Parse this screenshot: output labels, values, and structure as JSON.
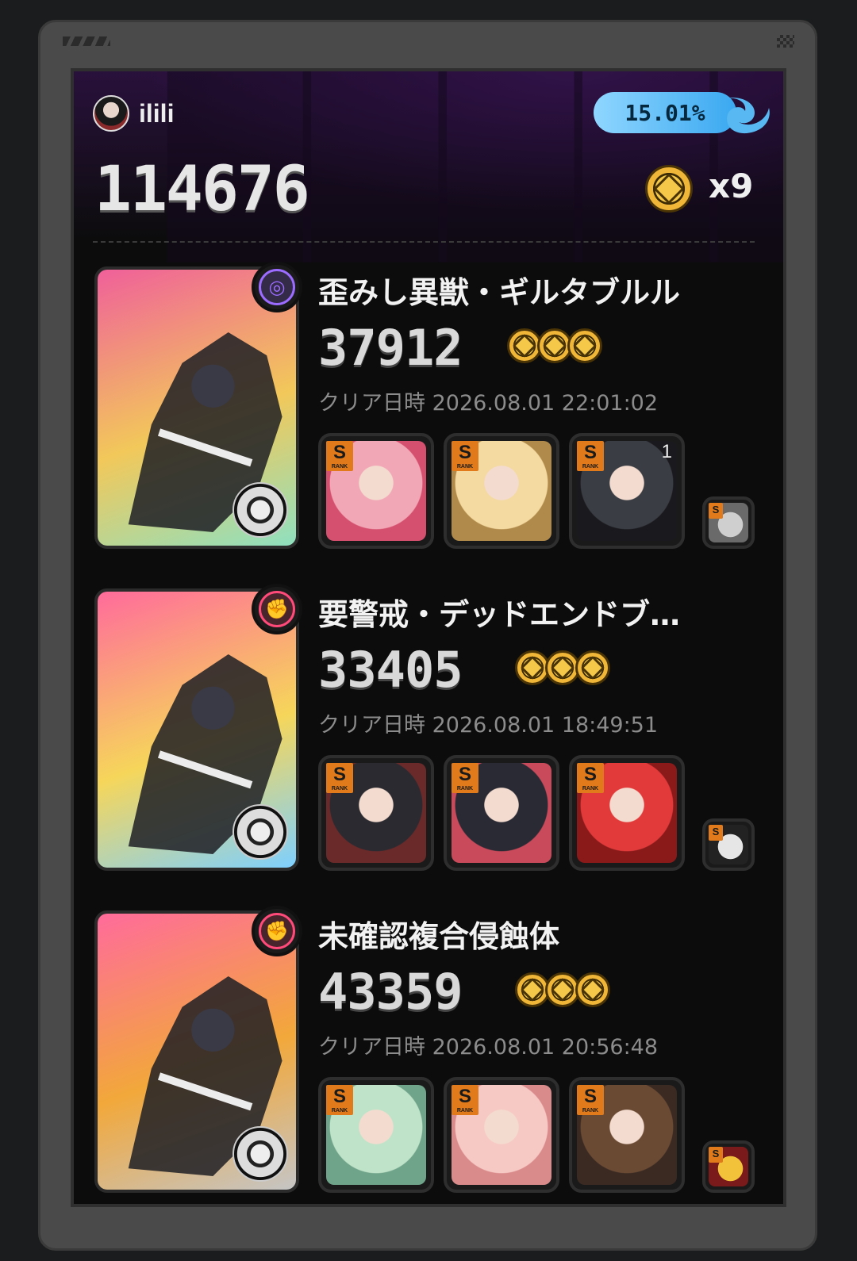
{
  "header": {
    "username": "ilili",
    "percent_badge": "15.01%",
    "total_score": "114676",
    "medal_count": "x9"
  },
  "entries": [
    {
      "boss_name": "歪みし異獣・ギルタブルル",
      "score": "37912",
      "medals": 3,
      "clear_label": "クリア日時",
      "clear_time": "2026.08.01 22:01:02",
      "attribute_icon": "ether-icon",
      "attribute_color": "#9b6cff",
      "card_gradient": [
        "#f0609a",
        "#f2c85a",
        "#8fe0c0"
      ],
      "agents": [
        {
          "rank": "S",
          "mindscape": "",
          "colors": [
            "#f2a7b6",
            "#d5506e"
          ]
        },
        {
          "rank": "S",
          "mindscape": "",
          "colors": [
            "#f4d9a0",
            "#b08a4a"
          ]
        },
        {
          "rank": "S",
          "mindscape": "1",
          "colors": [
            "#3a3d44",
            "#1a1a1e"
          ]
        }
      ],
      "bangboo": {
        "rank": "S",
        "colors": [
          "#cfcfcf",
          "#6a6a6a"
        ]
      }
    },
    {
      "boss_name": "要警戒・デッドエンドブ…",
      "score": "33405",
      "medals": 3,
      "clear_label": "クリア日時",
      "clear_time": "2026.08.01 18:49:51",
      "attribute_icon": "fist-icon",
      "attribute_color": "#ff4a7a",
      "card_gradient": [
        "#ff6b9b",
        "#f6d65a",
        "#7ed0ff"
      ],
      "agents": [
        {
          "rank": "S",
          "mindscape": "",
          "colors": [
            "#2a2a30",
            "#6a2a2a"
          ]
        },
        {
          "rank": "S",
          "mindscape": "",
          "colors": [
            "#2a2a34",
            "#c94a5a"
          ]
        },
        {
          "rank": "S",
          "mindscape": "",
          "colors": [
            "#e23a3a",
            "#8a1a1a"
          ]
        }
      ],
      "bangboo": {
        "rank": "S",
        "colors": [
          "#e6e6e6",
          "#222222"
        ]
      }
    },
    {
      "boss_name": "未確認複合侵蝕体",
      "score": "43359",
      "medals": 3,
      "clear_label": "クリア日時",
      "clear_time": "2026.08.01 20:56:48",
      "attribute_icon": "fist-icon",
      "attribute_color": "#ff4a7a",
      "card_gradient": [
        "#ff6b9b",
        "#f2a83a",
        "#c5c5c5"
      ],
      "agents": [
        {
          "rank": "S",
          "mindscape": "",
          "colors": [
            "#bfe3c8",
            "#6fa38a"
          ]
        },
        {
          "rank": "S",
          "mindscape": "",
          "colors": [
            "#f7c9c4",
            "#d98b8b"
          ]
        },
        {
          "rank": "S",
          "mindscape": "",
          "colors": [
            "#6b4a34",
            "#3a2a22"
          ]
        }
      ],
      "bangboo": {
        "rank": "S",
        "colors": [
          "#f2c23a",
          "#7a1a1a"
        ]
      }
    }
  ]
}
